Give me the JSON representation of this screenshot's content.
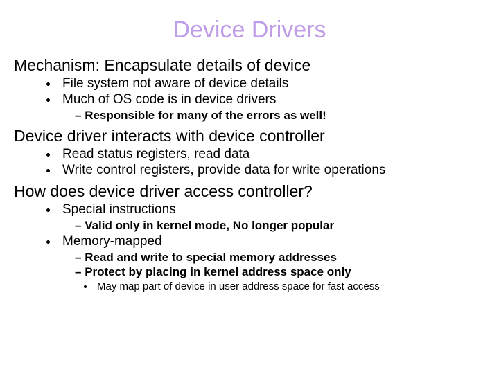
{
  "title": "Device Drivers",
  "sections": [
    {
      "heading": "Mechanism: Encapsulate details of device",
      "bullets": [
        {
          "text": "File system not aware of device details"
        },
        {
          "text": "Much of OS code is in device drivers",
          "dashes": [
            {
              "text": "Responsible for many of the errors as well!"
            }
          ]
        }
      ]
    },
    {
      "heading": "Device driver interacts with device controller",
      "bullets": [
        {
          "text": "Read status registers, read data"
        },
        {
          "text": "Write control registers, provide data for write operations"
        }
      ]
    },
    {
      "heading": "How does device driver access controller?",
      "bullets": [
        {
          "text": "Special instructions",
          "dashes": [
            {
              "text": "Valid only in kernel mode, No longer popular"
            }
          ]
        },
        {
          "text": "Memory-mapped",
          "dashes": [
            {
              "text": "Read and write to special memory addresses"
            },
            {
              "text": "Protect by placing in kernel address space only",
              "subbullets": [
                {
                  "text": "May map part of device in user address space for fast access"
                }
              ]
            }
          ]
        }
      ]
    }
  ]
}
